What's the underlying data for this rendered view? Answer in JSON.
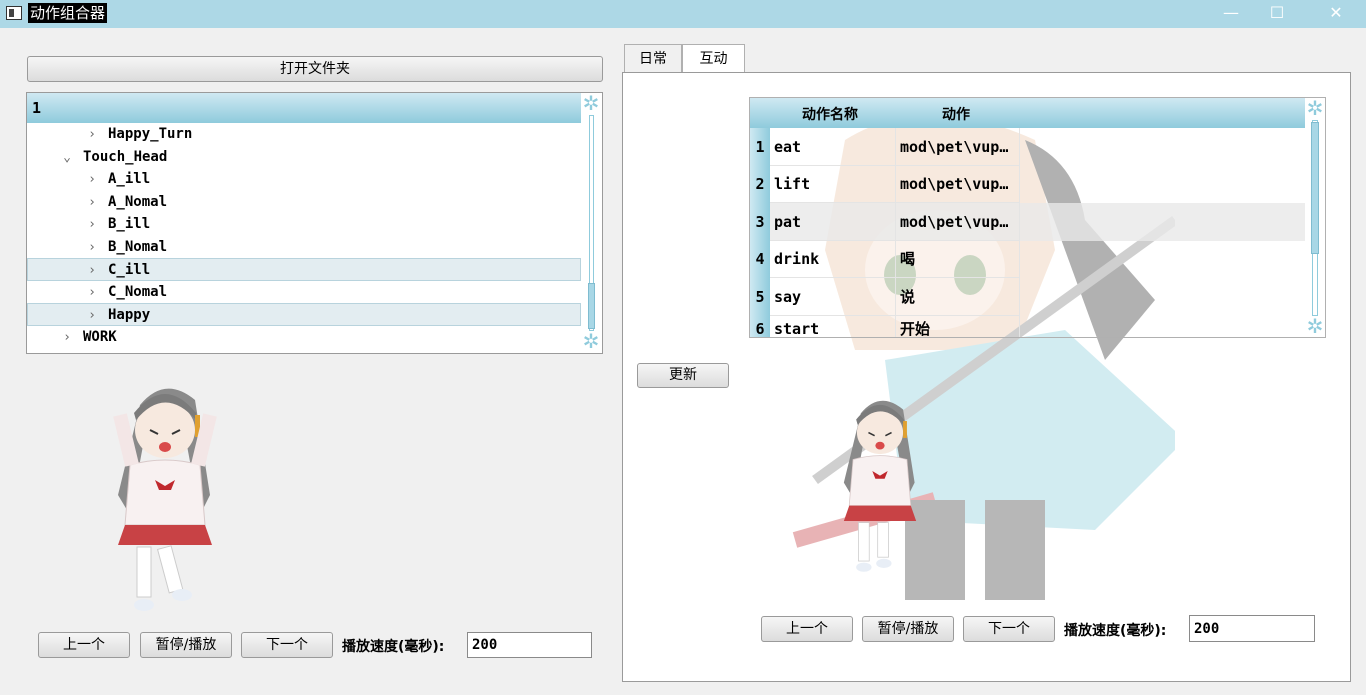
{
  "window": {
    "title": "动作组合器",
    "minimize": "—",
    "maximize": "☐",
    "close": "✕"
  },
  "left": {
    "open_folder": "打开文件夹",
    "tree": {
      "header": "1",
      "rows": [
        {
          "label": "Happy_Turn",
          "arrow": "›"
        },
        {
          "label": "Touch_Head",
          "arrow": "⌄"
        },
        {
          "label": "A_ill",
          "arrow": "›"
        },
        {
          "label": "A_Nomal",
          "arrow": "›"
        },
        {
          "label": "B_ill",
          "arrow": "›"
        },
        {
          "label": "B_Nomal",
          "arrow": "›"
        },
        {
          "label": "C_ill",
          "arrow": "›"
        },
        {
          "label": "C_Nomal",
          "arrow": "›"
        },
        {
          "label": "Happy",
          "arrow": "›"
        },
        {
          "label": "WORK",
          "arrow": "›"
        }
      ]
    },
    "controls": {
      "prev": "上一个",
      "pause_play": "暂停/播放",
      "next": "下一个",
      "speed_label": "播放速度(毫秒):",
      "speed_value": "200"
    }
  },
  "right": {
    "tabs": [
      "日常",
      "互动"
    ],
    "active_tab": "互动",
    "table": {
      "columns": [
        "动作名称",
        "动作"
      ],
      "rows": [
        {
          "num": "1",
          "name": "eat",
          "action": "mod\\pet\\vup…"
        },
        {
          "num": "2",
          "name": "lift",
          "action": "mod\\pet\\vup…"
        },
        {
          "num": "3",
          "name": "pat",
          "action": "mod\\pet\\vup…"
        },
        {
          "num": "4",
          "name": "drink",
          "action": "喝"
        },
        {
          "num": "5",
          "name": "say",
          "action": "说"
        },
        {
          "num": "6",
          "name": "start",
          "action": "开始"
        }
      ]
    },
    "update": "更新",
    "controls": {
      "prev": "上一个",
      "pause_play": "暂停/播放",
      "next": "下一个",
      "speed_label": "播放速度(毫秒):",
      "speed_value": "200"
    }
  },
  "icons": [
    "window-icon",
    "gear-icon",
    "chevron-right-icon",
    "chevron-down-icon"
  ],
  "colors": {
    "titlebar": "#add8e6",
    "header_gradient_top": "#cfe9f2",
    "header_gradient_bottom": "#8fcbdc",
    "row_highlight": "#e3edf1"
  }
}
